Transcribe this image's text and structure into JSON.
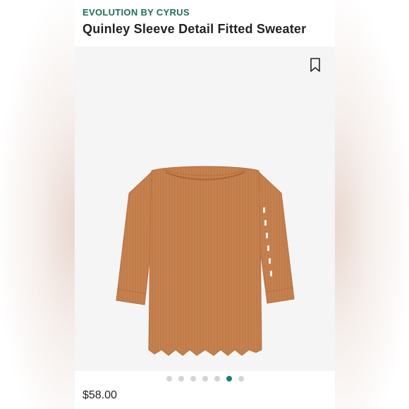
{
  "product": {
    "brand": "EVOLUTION BY CYRUS",
    "title": "Quinley Sleeve Detail Fitted Sweater",
    "price": "$58.00"
  },
  "gallery": {
    "image_count": 7,
    "active_index": 5
  },
  "colors": {
    "brand_text": "#1f6e5a",
    "active_dot": "#1a7f7a",
    "inactive_dot": "#d4d4d4",
    "sweater": "#c6814f"
  },
  "icons": {
    "bookmark": "bookmark-icon"
  }
}
